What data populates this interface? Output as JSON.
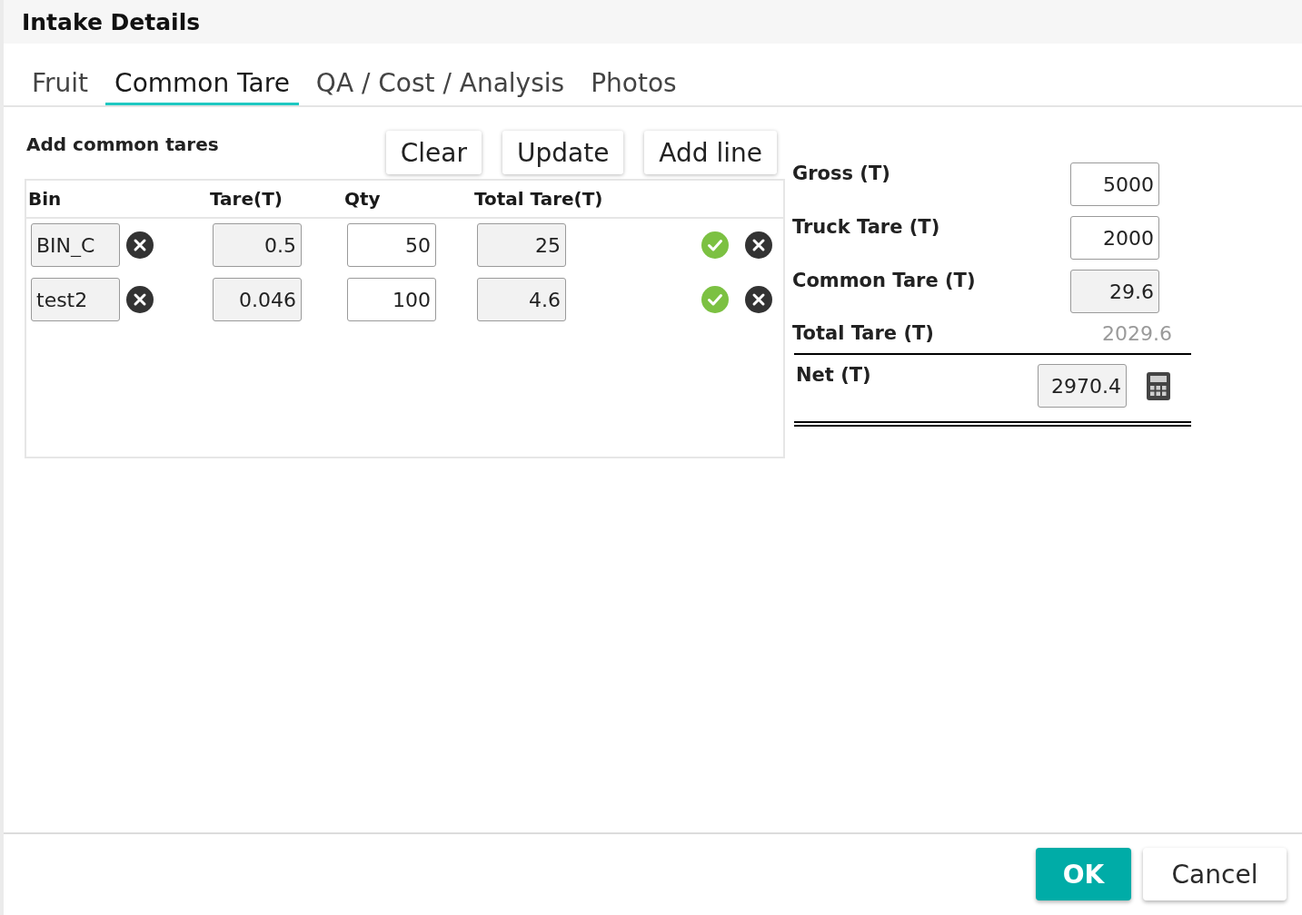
{
  "dialog": {
    "title": "Intake Details"
  },
  "tabs": [
    {
      "label": "Fruit",
      "selected": false
    },
    {
      "label": "Common Tare",
      "selected": true
    },
    {
      "label": "QA / Cost / Analysis",
      "selected": false
    },
    {
      "label": "Photos",
      "selected": false
    }
  ],
  "common_tares": {
    "heading": "Add common tares",
    "buttons": [
      "Clear",
      "Update",
      "Add line"
    ],
    "columns": [
      "Bin",
      "Tare(T)",
      "Qty",
      "Total Tare(T)"
    ],
    "rows": [
      {
        "cells": [
          {
            "value": "BIN_C",
            "readonly": true
          },
          {
            "value": "0.5",
            "readonly": true
          },
          {
            "value": "50",
            "readonly": false
          },
          {
            "value": "25",
            "readonly": true
          }
        ]
      },
      {
        "cells": [
          {
            "value": "test2",
            "readonly": true
          },
          {
            "value": "0.046",
            "readonly": true
          },
          {
            "value": "100",
            "readonly": false
          },
          {
            "value": "4.6",
            "readonly": true
          }
        ]
      }
    ]
  },
  "totals": {
    "fields": [
      {
        "label": "Gross (T)",
        "value": "5000",
        "readonly": false
      },
      {
        "label": "Truck Tare (T)",
        "value": "2000",
        "readonly": false
      },
      {
        "label": "Common Tare (T)",
        "value": "29.6",
        "readonly": true
      }
    ],
    "total_tare": {
      "label": "Total Tare (T)",
      "value": "2029.6"
    },
    "net": {
      "label": "Net (T)",
      "value": "2970.4",
      "readonly": true
    }
  },
  "footer_buttons": [
    {
      "label": "OK",
      "kind": "primary"
    },
    {
      "label": "Cancel",
      "kind": "secondary"
    }
  ]
}
